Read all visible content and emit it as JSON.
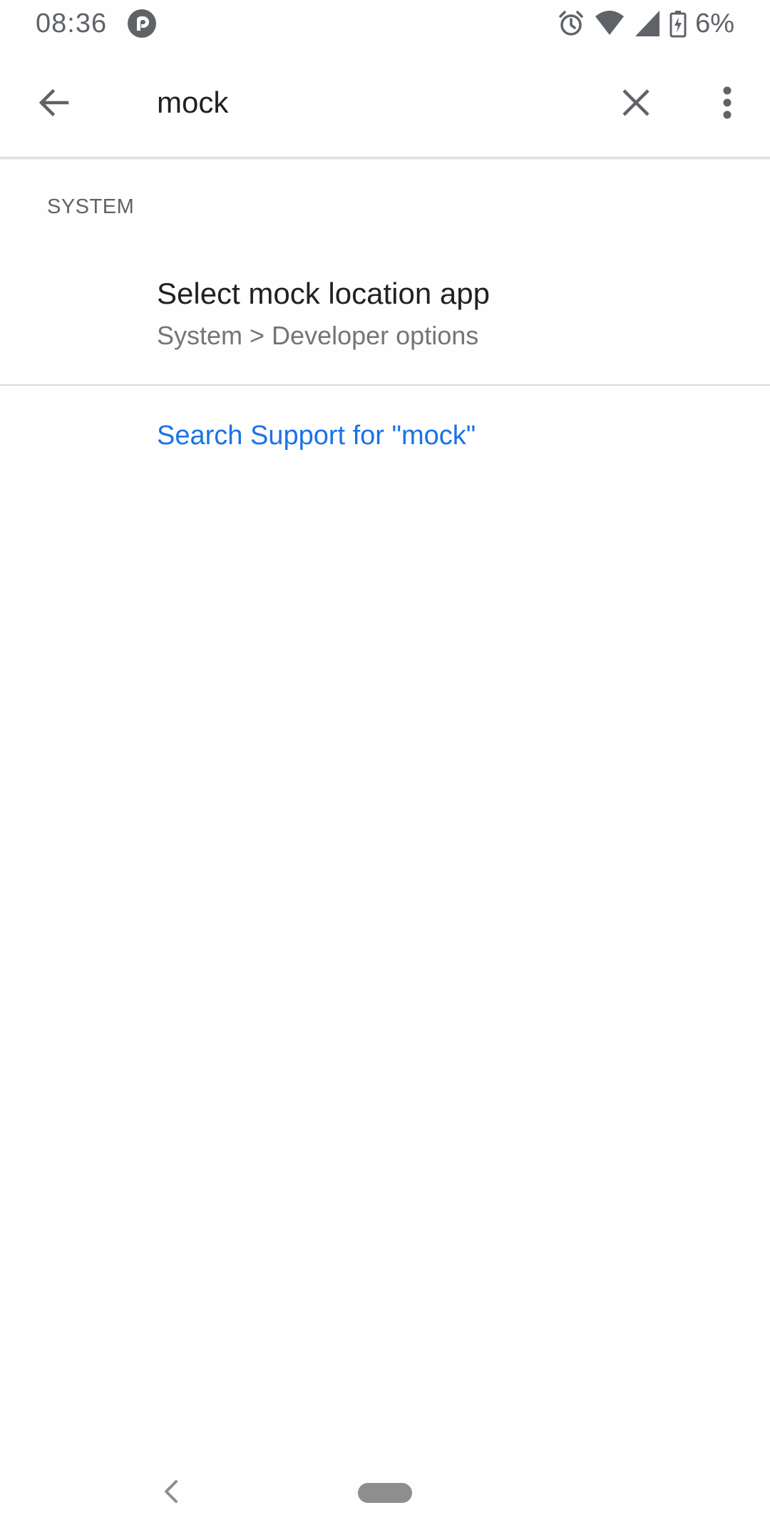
{
  "status_bar": {
    "time": "08:36",
    "battery_percent": "6%",
    "icons": [
      "pocket-casts-icon",
      "alarm-icon",
      "wifi-icon",
      "cell-signal-icon",
      "battery-charging-icon"
    ]
  },
  "toolbar": {
    "search_value": "mock",
    "icons": [
      "back-arrow-icon",
      "close-icon",
      "more-vert-icon"
    ]
  },
  "results": {
    "section_header": "SYSTEM",
    "items": [
      {
        "title": "Select mock location app",
        "subtitle": "System > Developer options"
      }
    ],
    "support_link": "Search Support for \"mock\""
  },
  "colors": {
    "accent": "#1a73e8",
    "text_primary": "#202124",
    "text_secondary": "#757575",
    "icon": "#5f6368"
  },
  "nav_bar": {
    "icons": [
      "nav-back-icon",
      "home-pill-icon"
    ]
  }
}
